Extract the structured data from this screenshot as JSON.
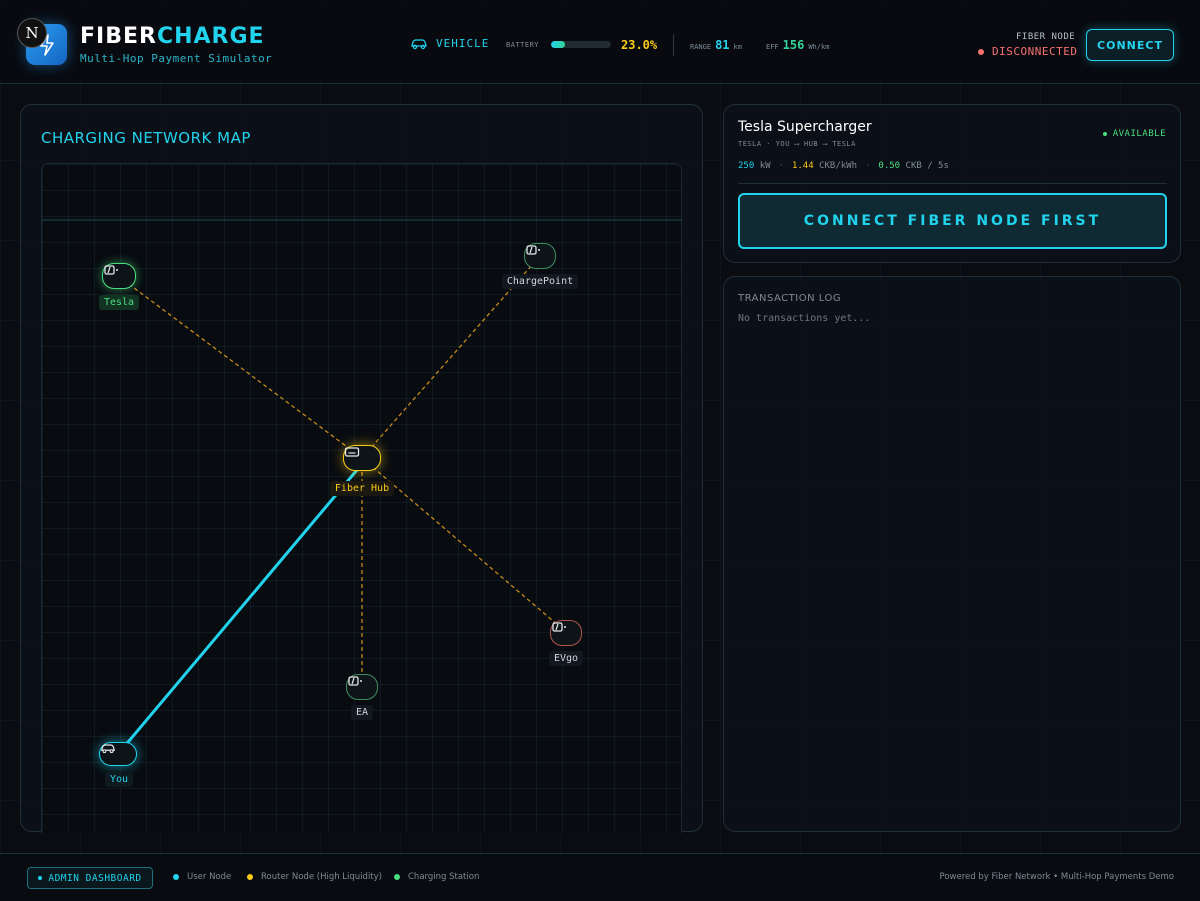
{
  "header": {
    "brand_part1": "FIBER",
    "brand_part2": "CHARGE",
    "subtitle": "Multi-Hop Payment Simulator",
    "badge_letter": "N",
    "vehicle_label": "VEHICLE",
    "battery_label": "BATTERY",
    "battery_percent_text": "23.0%",
    "battery_fraction": 0.23,
    "range_label": "RANGE",
    "range_value": "81",
    "range_unit": "km",
    "eff_label": "EFF",
    "eff_value": "156",
    "eff_unit": "Wh/km",
    "fiber_node_label": "FIBER NODE",
    "fiber_status": "DISCONNECTED",
    "connect_label": "CONNECT"
  },
  "map": {
    "title": "CHARGING NETWORK MAP",
    "nodes": [
      {
        "id": "tesla",
        "label": "Tesla",
        "kind": "station",
        "color": "#4ade80"
      },
      {
        "id": "chargepoint",
        "label": "ChargePoint",
        "kind": "station",
        "color": "#4ade80"
      },
      {
        "id": "hub",
        "label": "Fiber Hub",
        "kind": "router",
        "color": "#facc15"
      },
      {
        "id": "evgo",
        "label": "EVgo",
        "kind": "station",
        "color": "#f87171"
      },
      {
        "id": "ea",
        "label": "EA",
        "kind": "station",
        "color": "#4ade80"
      },
      {
        "id": "you",
        "label": "You",
        "kind": "user",
        "color": "#22d3ee"
      }
    ]
  },
  "station": {
    "name": "Tesla Supercharger",
    "route": "TESLA · YOU ⟶ HUB ⟶ TESLA",
    "status": "AVAILABLE",
    "power_value": "250",
    "power_unit": "kW",
    "price_value": "1.44",
    "price_unit": "CKB/kWh",
    "rate_value": "0.50",
    "rate_unit": "CKB / 5s",
    "action_label": "CONNECT FIBER NODE FIRST"
  },
  "log": {
    "title": "TRANSACTION LOG",
    "empty_text": "No transactions yet..."
  },
  "footer": {
    "admin_label": "ADMIN DASHBOARD",
    "legend": [
      {
        "label": "User Node",
        "color": "#22d3ee"
      },
      {
        "label": "Router Node (High Liquidity)",
        "color": "#facc15"
      },
      {
        "label": "Charging Station",
        "color": "#4ade80"
      }
    ],
    "credit": "Powered by Fiber Network • Multi-Hop Payments Demo"
  },
  "colors": {
    "accent": "#22d3ee",
    "warn": "#facc15",
    "ok": "#4ade80",
    "error": "#f87171"
  }
}
